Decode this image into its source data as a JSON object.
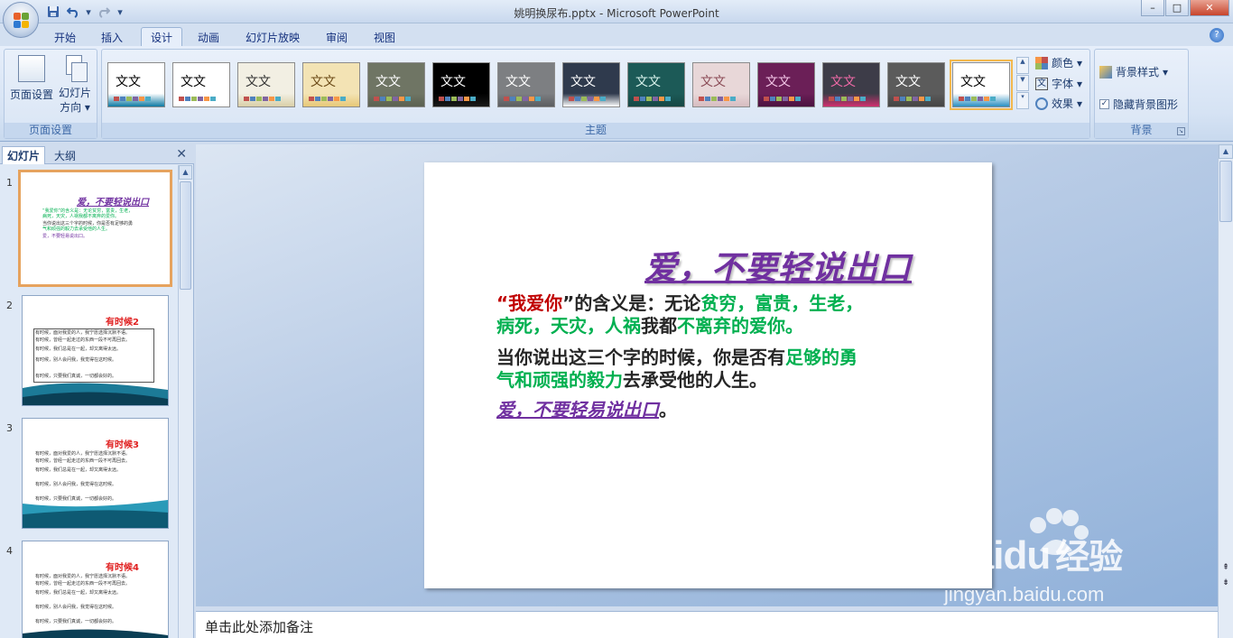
{
  "window": {
    "title": "姚明换尿布.pptx - Microsoft PowerPoint",
    "controls": {
      "minimize": "–",
      "maximize": "□",
      "close": "✕"
    }
  },
  "quick_access": {
    "save": "save-icon",
    "undo": "undo-icon",
    "redo": "redo-icon",
    "more": "▾"
  },
  "ribbon_tabs": [
    "开始",
    "插入",
    "设计",
    "动画",
    "幻灯片放映",
    "审阅",
    "视图"
  ],
  "active_tab": "设计",
  "page_setup_group": {
    "label": "页面设置",
    "page_setup_button": "页面设置",
    "orientation_button_line1": "幻灯片",
    "orientation_button_line2": "方向"
  },
  "themes_group": {
    "label": "主题",
    "theme_text": "文文",
    "themes": [
      {
        "bg": "#ffffff",
        "fg": "#000000",
        "band": "#0e7aa3",
        "selected": false
      },
      {
        "bg": "#ffffff",
        "fg": "#000000",
        "band": "#ffffff",
        "selected": false
      },
      {
        "bg": "#f2efe3",
        "fg": "#333333",
        "band": "#d9cfa8",
        "selected": false
      },
      {
        "bg": "#f3e3b4",
        "fg": "#6b4a16",
        "band": "#e7c878",
        "selected": false
      },
      {
        "bg": "#6f7564",
        "fg": "#ffffff",
        "band": "#5b6151",
        "selected": false
      },
      {
        "bg": "#000000",
        "fg": "#ffffff",
        "band": "#1a1a1a",
        "selected": false
      },
      {
        "bg": "#7d7f82",
        "fg": "#ffffff",
        "band": "#5b5d60",
        "selected": false
      },
      {
        "bg": "#2f3a4d",
        "fg": "#ffffff",
        "band": "#ffffff",
        "selected": false
      },
      {
        "bg": "#1c5a57",
        "fg": "#d9f3ec",
        "band": "#164744",
        "selected": false
      },
      {
        "bg": "#e8d7d8",
        "fg": "#8a4a55",
        "band": "#d6bcc0",
        "selected": false
      },
      {
        "bg": "#6b1f57",
        "fg": "#f3c6e7",
        "band": "#4b1240",
        "selected": false
      },
      {
        "bg": "#3d3c48",
        "fg": "#f06aa7",
        "band": "#d0306f",
        "selected": false
      },
      {
        "bg": "#5b5b5b",
        "fg": "#ffffff",
        "band": "#444444",
        "selected": false
      },
      {
        "bg": "#ffffff",
        "fg": "#000000",
        "band": "#2a8fc2",
        "selected": true
      }
    ],
    "colors_button": "颜色",
    "fonts_button": "字体",
    "effects_button": "效果"
  },
  "background_group": {
    "label": "背景",
    "background_styles": "背景样式",
    "hide_background": "隐藏背景图形",
    "hide_background_checked": true
  },
  "left_panel": {
    "tab_slides": "幻灯片",
    "tab_outline": "大纲",
    "close": "✕",
    "thumbs": [
      {
        "num": "1",
        "title": "爱，不要轻说出口"
      },
      {
        "num": "2",
        "title": "有时候2"
      },
      {
        "num": "3",
        "title": "有时候3"
      },
      {
        "num": "4",
        "title": "有时候4"
      }
    ],
    "thumb_lines": [
      "有时候，面对我爱的人，我宁愿选择沉默不语。",
      "有时候，曾经一起走过的东西一段不可再回去。",
      "有时候，我们总是在一起，却又离得太远。",
      "有时候，别人会问我，我觉得在这时候。",
      "有时候，只要我们真诚，一切都会好的。"
    ],
    "thumb1_lines": [
      "“我爱你”的含义是：无论贫穷，富贵，生老，",
      "病死，天灾，人祸我都不离弃的爱你。",
      "当你说出这三个字的时候，你是否有足够的勇",
      "气和顽强的毅力去承受他的人生。",
      "爱，不要轻易说出口。"
    ]
  },
  "slide": {
    "title": "爱，不要轻说出口",
    "p1_quote_open": "“",
    "p1_love": "我爱你",
    "p1_quote_close": "”",
    "p1_mid": "的含义是：无论",
    "p1_green1": "贫穷，富贵，生老，",
    "p2_green": "病死，天灾，人祸",
    "p2_mid": "我都",
    "p2_green2": "不离弃的爱你。",
    "p3_start": "当你说出这三个字的时候，你是否有",
    "p3_green": "足够的勇",
    "p4_green": "气和顽强的毅力",
    "p4_end": "去承受他的人生。",
    "p5_purple": "爱，不要轻易说出口",
    "p5_end": "。"
  },
  "notes_placeholder": "单击此处添加备注",
  "watermark": {
    "brand": "Baidu",
    "cn": "经验",
    "url": "jingyan.baidu.com"
  },
  "colors": {
    "title_purple": "#7030a0",
    "love_red": "#c00000",
    "green": "#00b050",
    "text_dark": "#262626",
    "thumb_title_red": "#e02020",
    "selection_orange": "#e6a35e"
  }
}
